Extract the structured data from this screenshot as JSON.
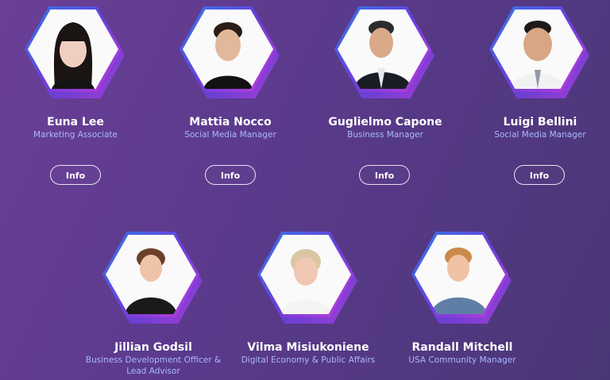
{
  "team": [
    {
      "name": "Euna Lee",
      "role": "Marketing Associate",
      "info_label": "Info"
    },
    {
      "name": "Mattia Nocco",
      "role": "Social Media Manager",
      "info_label": "Info"
    },
    {
      "name": "Guglielmo Capone",
      "role": "Business Manager",
      "info_label": "Info"
    },
    {
      "name": "Luigi Bellini",
      "role": "Social Media Manager",
      "info_label": "Info"
    },
    {
      "name": "Jillian Godsil",
      "role": "Business Development Officer & Lead Advisor"
    },
    {
      "name": "Vilma Misiukoniene",
      "role": "Digital Economy & Public Affairs"
    },
    {
      "name": "Randall Mitchell",
      "role": "USA Community Manager"
    }
  ],
  "colors": {
    "accent": "#a9b8ff",
    "hex_ring_start": "#2f7be6",
    "hex_ring_end": "#c53bd6"
  }
}
